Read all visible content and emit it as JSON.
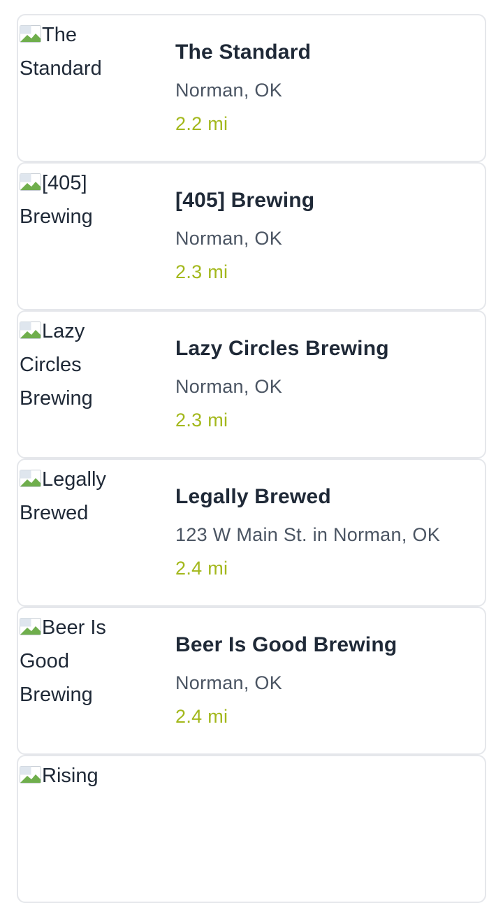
{
  "breweries": [
    {
      "image_alt": "The Standard",
      "name": "The Standard",
      "location": "Norman, OK",
      "distance": "2.2 mi"
    },
    {
      "image_alt": "[405] Brewing",
      "name": "[405] Brewing",
      "location": "Norman, OK",
      "distance": "2.3 mi"
    },
    {
      "image_alt": "Lazy Circles Brewing",
      "name": "Lazy Circles Brewing",
      "location": "Norman, OK",
      "distance": "2.3 mi"
    },
    {
      "image_alt": "Legally Brewed",
      "name": "Legally Brewed",
      "location": "123 W Main St. in Norman, OK",
      "distance": "2.4 mi"
    },
    {
      "image_alt": "Beer Is Good Brewing",
      "name": "Beer Is Good Brewing",
      "location": "Norman, OK",
      "distance": "2.4 mi"
    },
    {
      "image_alt": "Rising"
    }
  ],
  "colors": {
    "name_text": "#1f2937",
    "location_text": "#4b5563",
    "distance_text": "#a3b81c",
    "card_border": "#e5e7eb"
  },
  "icons": {
    "broken_image": "broken-image-icon"
  }
}
